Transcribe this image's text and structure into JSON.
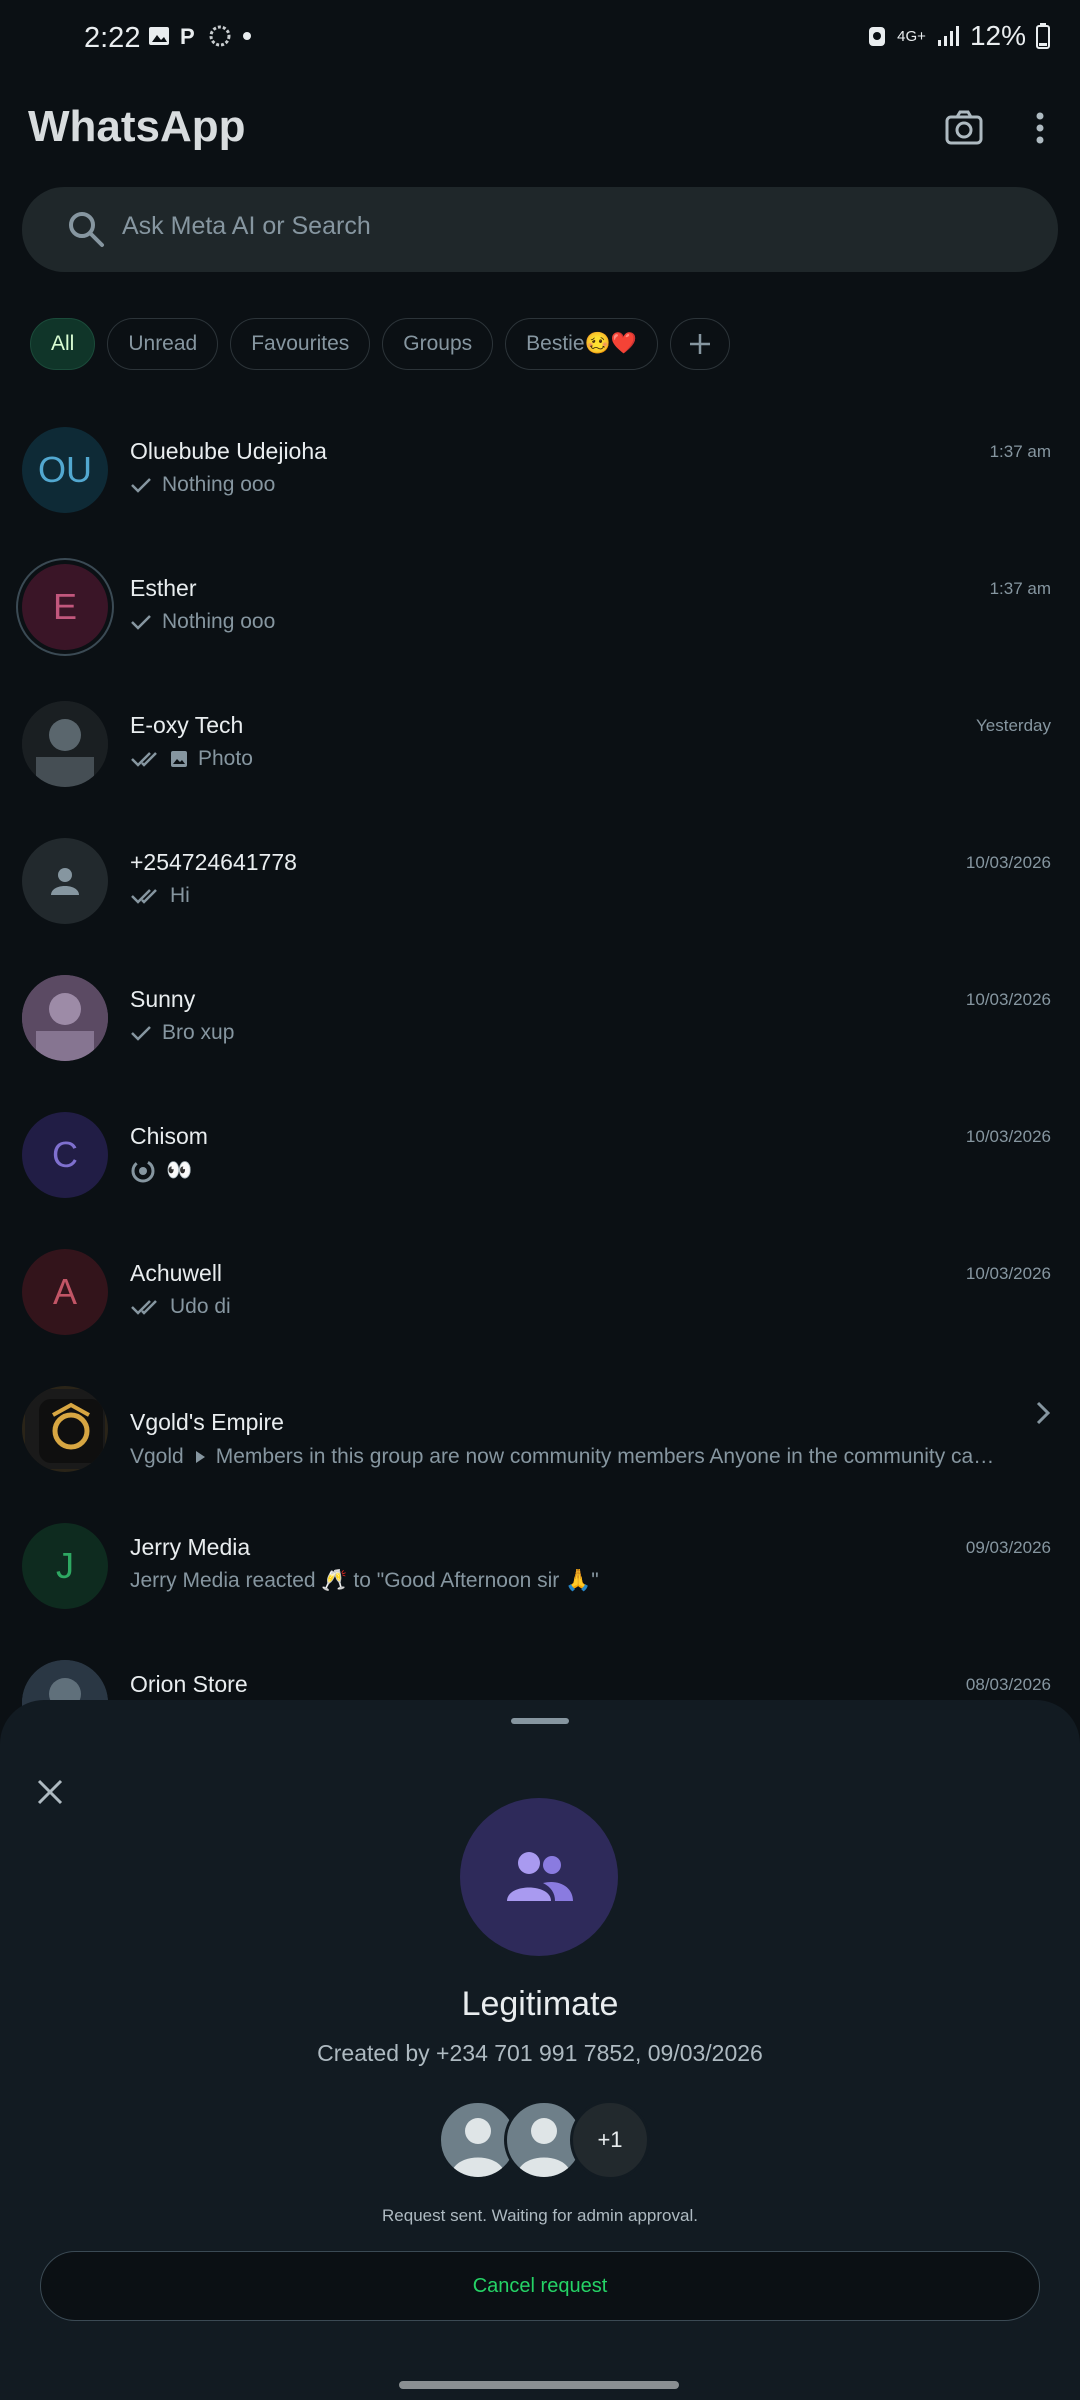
{
  "status_bar": {
    "time": "2:22",
    "battery": "12%",
    "network": "4G+"
  },
  "app": {
    "title": "WhatsApp"
  },
  "search": {
    "placeholder": "Ask Meta AI or Search"
  },
  "filters": [
    {
      "label": "All",
      "active": true
    },
    {
      "label": "Unread"
    },
    {
      "label": "Favourites"
    },
    {
      "label": "Groups"
    },
    {
      "label": "Bestie🥴❤️"
    }
  ],
  "chats": [
    {
      "name": "Oluebube Udejioha",
      "initials": "OU",
      "time": "1:37 am",
      "preview": "Nothing ooo",
      "tick": "single",
      "avatar_bg": "#0e2a36",
      "avatar_fg": "#52a8d0"
    },
    {
      "name": "Esther",
      "initials": "E",
      "time": "1:37 am",
      "preview": "Nothing ooo",
      "tick": "single",
      "avatar_bg": "#3a1527",
      "avatar_fg": "#c2577d"
    },
    {
      "name": "E-oxy Tech",
      "initials": "",
      "time": "Yesterday",
      "preview": "Photo",
      "tick": "double",
      "avatar_bg": "#1a1f22",
      "avatar_fg": "#8696a0"
    },
    {
      "name": "+254724641778",
      "initials": "",
      "time": "10/03/2026",
      "preview": "Hi",
      "tick": "double",
      "avatar_bg": "#22292d",
      "avatar_fg": "#8696a0"
    },
    {
      "name": "Sunny",
      "initials": "",
      "time": "10/03/2026",
      "preview": "Bro xup",
      "tick": "single",
      "avatar_bg": "#5b4a63",
      "avatar_fg": "#c9b7d6"
    },
    {
      "name": "Chisom",
      "initials": "C",
      "time": "10/03/2026",
      "preview": "👀",
      "tick": "status",
      "avatar_bg": "#211d45",
      "avatar_fg": "#7f70cf"
    },
    {
      "name": "Achuwell",
      "initials": "A",
      "time": "10/03/2026",
      "preview": "Udo di",
      "tick": "double",
      "avatar_bg": "#33141b",
      "avatar_fg": "#c25566"
    },
    {
      "name": "Vgold's Empire",
      "initials": "",
      "time": "",
      "sender": "Vgold",
      "preview": "Members in this group are now community members Anyone in the community can...",
      "tick": "none",
      "avatar_bg": "#2a2418",
      "avatar_fg": "#d7a642"
    },
    {
      "name": "Jerry Media",
      "initials": "J",
      "time": "09/03/2026",
      "preview": "Jerry Media reacted 🥂 to \"Good Afternoon sir 🙏\"",
      "tick": "none",
      "avatar_bg": "#0e2b1f",
      "avatar_fg": "#2ea862"
    },
    {
      "name": "Orion Store",
      "initials": "",
      "time": "08/03/2026",
      "preview": "",
      "tick": "none",
      "avatar_bg": "#2a3744",
      "avatar_fg": "#8696a0"
    }
  ],
  "sheet": {
    "group_name": "Legitimate",
    "created": "Created by +234 701 991 7852, 09/03/2026",
    "more_members": "+1",
    "request_status": "Request sent. Waiting for admin approval.",
    "cancel_label": "Cancel request"
  }
}
